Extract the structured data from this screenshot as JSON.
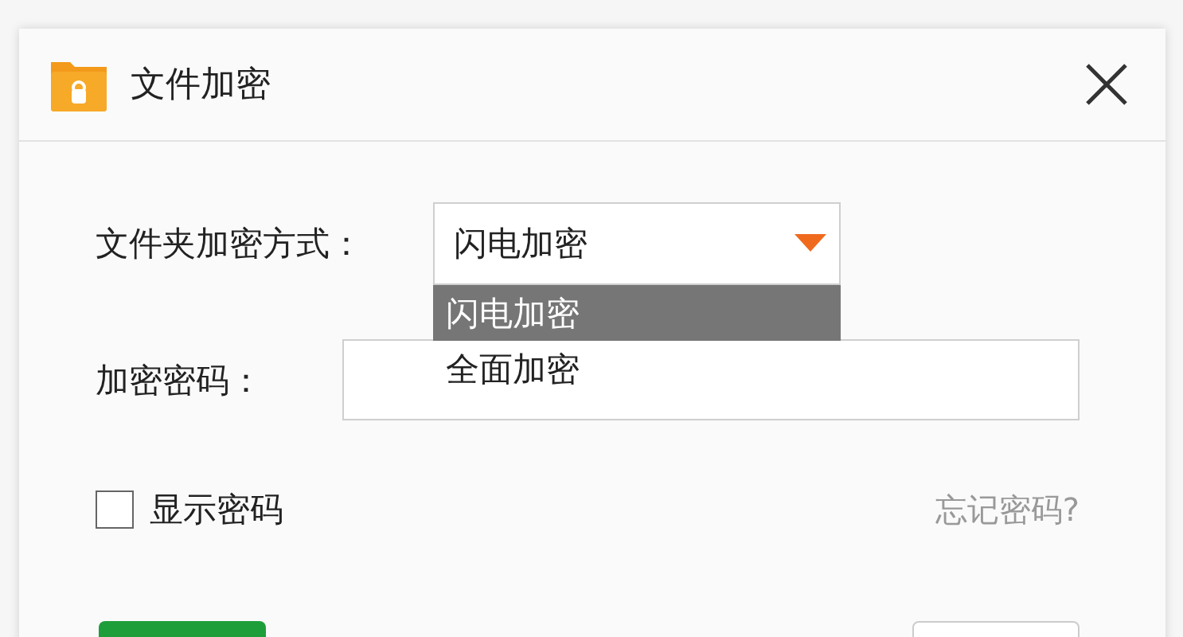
{
  "dialog": {
    "title": "文件加密"
  },
  "method": {
    "label": "文件夹加密方式：",
    "value": "闪电加密",
    "expanded": true,
    "options": [
      {
        "label": "闪电加密",
        "selected": true
      },
      {
        "label": "全面加密",
        "selected": false
      }
    ]
  },
  "password": {
    "label": "加密密码："
  },
  "show_password": {
    "label": "显示密码",
    "checked": false
  },
  "forgot_link": "忘记密码?",
  "buttons": [
    {
      "kind": "primary"
    },
    {
      "kind": "secondary"
    }
  ]
}
